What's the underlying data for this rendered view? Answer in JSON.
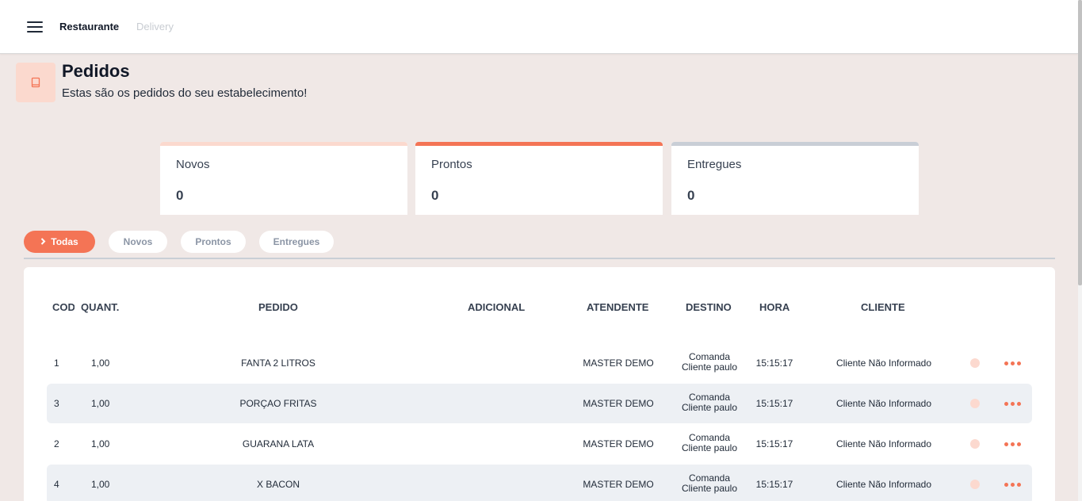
{
  "topbar": {
    "tabs": [
      {
        "label": "Restaurante",
        "active": true
      },
      {
        "label": "Delivery",
        "active": false
      }
    ]
  },
  "header": {
    "title": "Pedidos",
    "subtitle": "Estas são os pedidos do seu estabelecimento!",
    "icon": "book-icon"
  },
  "stats": [
    {
      "label": "Novos",
      "value": "0",
      "color": "#fbd9ce"
    },
    {
      "label": "Prontos",
      "value": "0",
      "color": "#f47455"
    },
    {
      "label": "Entregues",
      "value": "0",
      "color": "#c9ced6"
    }
  ],
  "filters": [
    {
      "label": "Todas",
      "active": true
    },
    {
      "label": "Novos",
      "active": false
    },
    {
      "label": "Prontos",
      "active": false
    },
    {
      "label": "Entregues",
      "active": false
    }
  ],
  "table": {
    "columns": [
      "COD",
      "QUANT.",
      "PEDIDO",
      "ADICIONAL",
      "ATENDENTE",
      "DESTINO",
      "HORA",
      "CLIENTE"
    ],
    "rows": [
      {
        "cod": "1",
        "quant": "1,00",
        "pedido": "FANTA 2 LITROS",
        "adicional": "",
        "atendente": "MASTER DEMO",
        "destino_1": "Comanda",
        "destino_2": "Cliente paulo",
        "hora": "15:15:17",
        "cliente": "Cliente Não Informado"
      },
      {
        "cod": "3",
        "quant": "1,00",
        "pedido": "PORÇAO FRITAS",
        "adicional": "",
        "atendente": "MASTER DEMO",
        "destino_1": "Comanda",
        "destino_2": "Cliente paulo",
        "hora": "15:15:17",
        "cliente": "Cliente Não Informado"
      },
      {
        "cod": "2",
        "quant": "1,00",
        "pedido": "GUARANA LATA",
        "adicional": "",
        "atendente": "MASTER DEMO",
        "destino_1": "Comanda",
        "destino_2": "Cliente paulo",
        "hora": "15:15:17",
        "cliente": "Cliente Não Informado"
      },
      {
        "cod": "4",
        "quant": "1,00",
        "pedido": "X BACON",
        "adicional": "",
        "atendente": "MASTER DEMO",
        "destino_1": "Comanda",
        "destino_2": "Cliente paulo",
        "hora": "15:15:17",
        "cliente": "Cliente Não Informado"
      }
    ]
  },
  "colors": {
    "accent": "#f47455",
    "accent_light": "#fbd9ce",
    "background": "#f0e8e6",
    "row_shade": "#edf0f4"
  }
}
